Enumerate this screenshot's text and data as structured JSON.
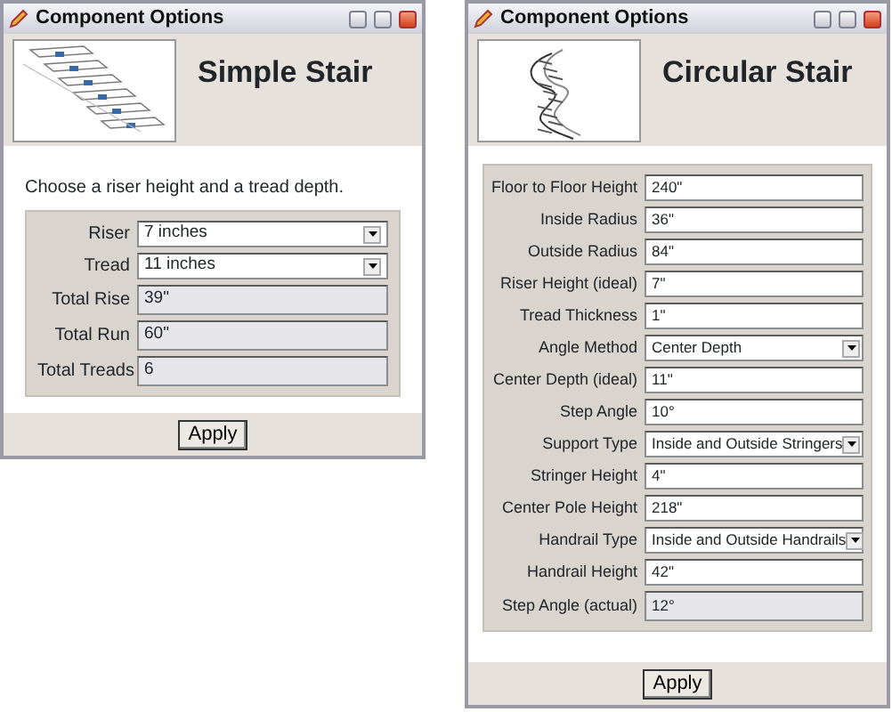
{
  "windows": [
    {
      "title": "Component Options",
      "heading": "Simple Stair",
      "instruction": "Choose a riser height and a tread depth.",
      "button": "Apply",
      "fields": [
        {
          "label": "Riser",
          "value": "7 inches",
          "kind": "select"
        },
        {
          "label": "Tread",
          "value": "11 inches",
          "kind": "select"
        },
        {
          "label": "Total Rise",
          "value": "39\"",
          "kind": "readonly"
        },
        {
          "label": "Total Run",
          "value": "60\"",
          "kind": "readonly"
        },
        {
          "label": "Total Treads",
          "value": "6",
          "kind": "readonly"
        }
      ]
    },
    {
      "title": "Component Options",
      "heading": "Circular Stair",
      "button": "Apply",
      "fields": [
        {
          "label": "Floor to Floor Height",
          "value": "240\"",
          "kind": "text"
        },
        {
          "label": "Inside Radius",
          "value": "36\"",
          "kind": "text"
        },
        {
          "label": "Outside Radius",
          "value": "84\"",
          "kind": "text"
        },
        {
          "label": "Riser Height (ideal)",
          "value": "7\"",
          "kind": "text"
        },
        {
          "label": "Tread Thickness",
          "value": "1\"",
          "kind": "text"
        },
        {
          "label": "Angle Method",
          "value": "Center Depth",
          "kind": "select"
        },
        {
          "label": "Center Depth (ideal)",
          "value": "11\"",
          "kind": "text"
        },
        {
          "label": "Step Angle",
          "value": "10°",
          "kind": "text"
        },
        {
          "label": "Support Type",
          "value": "Inside and Outside Stringers",
          "kind": "select"
        },
        {
          "label": "Stringer Height",
          "value": "4\"",
          "kind": "text"
        },
        {
          "label": "Center Pole Height",
          "value": "218\"",
          "kind": "text"
        },
        {
          "label": "Handrail Type",
          "value": "Inside and Outside Handrails",
          "kind": "select"
        },
        {
          "label": "Handrail Height",
          "value": "42\"",
          "kind": "text"
        },
        {
          "label": "Step Angle (actual)",
          "value": "12°",
          "kind": "readonly"
        }
      ]
    }
  ]
}
